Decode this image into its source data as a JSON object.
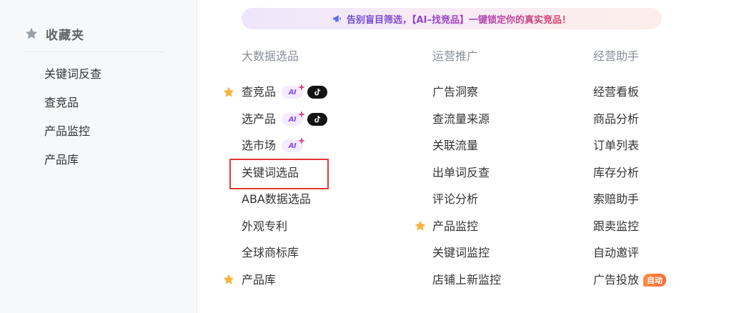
{
  "banner": {
    "text": "告别盲目筛选，【AI–找竞品】一键锁定你的真实竞品！",
    "icon": "megaphone-icon",
    "colors": {
      "start": "#6b4bd9",
      "end": "#e2425f"
    }
  },
  "sidebar": {
    "title": "收藏夹",
    "icon": "star-icon",
    "items": [
      {
        "label": "关键词反查"
      },
      {
        "label": "查竞品"
      },
      {
        "label": "产品监控"
      },
      {
        "label": "产品库"
      }
    ]
  },
  "columns": [
    {
      "title": "大数据选品",
      "items": [
        {
          "label": "查竞品",
          "starred": true,
          "ai": true,
          "tiktok": true
        },
        {
          "label": "选产品",
          "ai": true,
          "tiktok": true
        },
        {
          "label": "选市场",
          "ai": true
        },
        {
          "label": "关键词选品",
          "highlighted": true
        },
        {
          "label": "ABA数据选品"
        },
        {
          "label": "外观专利"
        },
        {
          "label": "全球商标库"
        },
        {
          "label": "产品库",
          "starred": true
        }
      ]
    },
    {
      "title": "运营推广",
      "items": [
        {
          "label": "广告洞察"
        },
        {
          "label": "查流量来源"
        },
        {
          "label": "关联流量"
        },
        {
          "label": "出单词反查"
        },
        {
          "label": "评论分析"
        },
        {
          "label": "产品监控",
          "starred": true
        },
        {
          "label": "关键词监控"
        },
        {
          "label": "店铺上新监控"
        }
      ]
    },
    {
      "title": "经营助手",
      "items": [
        {
          "label": "经营看板"
        },
        {
          "label": "商品分析"
        },
        {
          "label": "订单列表"
        },
        {
          "label": "库存分析"
        },
        {
          "label": "索赔助手"
        },
        {
          "label": "跟卖监控"
        },
        {
          "label": "自动邀评"
        },
        {
          "label": "广告投放",
          "auto_badge": "自动"
        }
      ]
    }
  ],
  "badges": {
    "ai": "AI"
  },
  "colors": {
    "star": "#f7b33b",
    "sidebar_star": "#9aa0a8",
    "highlight_box": "#e53935",
    "ai_badge_text": "#8a4df2",
    "auto_badge": "#ff7a3d"
  }
}
